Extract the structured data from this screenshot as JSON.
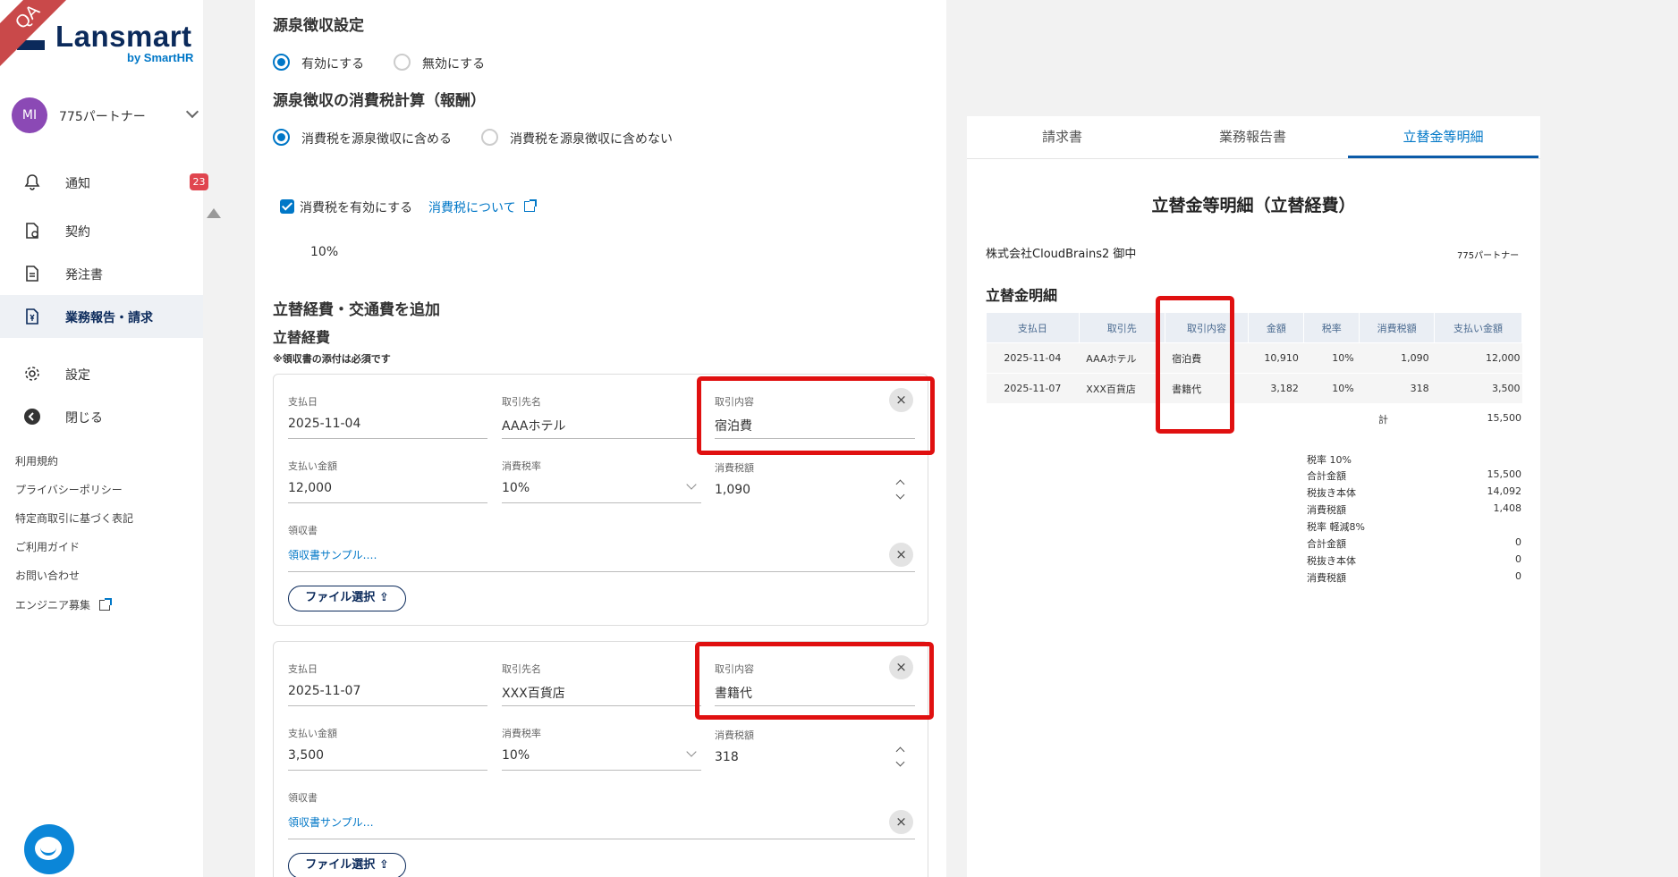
{
  "badge_qa": "QA",
  "brand": {
    "name": "Lansmart",
    "sub": "by SmartHR"
  },
  "user": {
    "initials": "MI",
    "name": "775パートナー"
  },
  "nav": [
    {
      "label": "通知",
      "badge": "23"
    },
    {
      "label": "契約"
    },
    {
      "label": "発注書"
    },
    {
      "label": "業務報告・請求"
    },
    {
      "label": "設定"
    },
    {
      "label": "閉じる"
    }
  ],
  "footer_links": [
    "利用規約",
    "プライバシーポリシー",
    "特定商取引に基づく表記",
    "ご利用ガイド",
    "お問い合わせ",
    "エンジニア募集"
  ],
  "withholding": {
    "title": "源泉徴収設定",
    "options": [
      "有効にする",
      "無効にする"
    ],
    "selected": 0,
    "tax_title": "源泉徴収の消費税計算（報酬）",
    "tax_options": [
      "消費税を源泉徴収に含める",
      "消費税を源泉徴収に含めない"
    ],
    "tax_selected": 0
  },
  "consumption": {
    "check_label": "消費税を有効にする",
    "checked": true,
    "link": "消費税について",
    "rate": "10%"
  },
  "expenses": {
    "title": "立替経費・交通費を追加",
    "subtitle": "立替経費",
    "note": "※領収書の添付は必須です",
    "labels": {
      "date": "支払日",
      "vendor": "取引先名",
      "content": "取引内容",
      "amount": "支払い金額",
      "tax_rate": "消費税率",
      "tax_amount": "消費税額",
      "receipt": "領収書",
      "file_button": "ファイル選択"
    },
    "items": [
      {
        "date": "2025-11-04",
        "vendor": "AAAホテル",
        "content": "宿泊費",
        "amount": "12,000",
        "tax_rate": "10%",
        "tax_amount": "1,090",
        "receipt": "領収書サンプル.…"
      },
      {
        "date": "2025-11-07",
        "vendor": "XXX百貨店",
        "content": "書籍代",
        "amount": "3,500",
        "tax_rate": "10%",
        "tax_amount": "318",
        "receipt": "領収書サンプル…"
      }
    ]
  },
  "preview": {
    "tabs": [
      "請求書",
      "業務報告書",
      "立替金等明細"
    ],
    "active_tab": 2,
    "doc_title": "立替金等明細（立替経費）",
    "recipient": "株式会社CloudBrains2 御中",
    "issuer": "775パートナー",
    "section": "立替金明細",
    "columns": [
      "支払日",
      "取引先",
      "取引内容",
      "金額",
      "税率",
      "消費税額",
      "支払い金額"
    ],
    "rows": [
      [
        "2025-11-04",
        "AAAホテル",
        "宿泊費",
        "10,910",
        "10%",
        "1,090",
        "12,000"
      ],
      [
        "2025-11-07",
        "XXX百貨店",
        "書籍代",
        "3,182",
        "10%",
        "318",
        "3,500"
      ]
    ],
    "total_label": "計",
    "total_value": "15,500",
    "summary": [
      {
        "label": "税率 10%",
        "value": ""
      },
      {
        "label": "合計金額",
        "value": "15,500"
      },
      {
        "label": "税抜き本体",
        "value": "14,092"
      },
      {
        "label": "消費税額",
        "value": "1,408"
      },
      {
        "label": "税率 軽減8%",
        "value": ""
      },
      {
        "label": "合計金額",
        "value": "0"
      },
      {
        "label": "税抜き本体",
        "value": "0"
      },
      {
        "label": "消費税額",
        "value": "0"
      }
    ]
  },
  "colors": {
    "brand": "#0b2a5b",
    "accent": "#0077c7",
    "highlight": "#e01010",
    "badge": "#e0454f"
  }
}
